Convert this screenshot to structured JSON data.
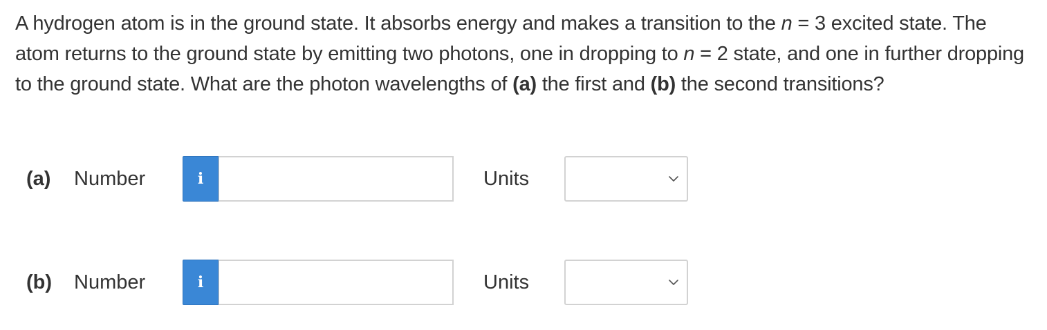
{
  "question": {
    "s1": "A hydrogen atom is in the ground state. It absorbs energy and makes a transition to the ",
    "var1": "n",
    "s2": " = 3 excited state. The atom returns to the ground state by emitting two photons, one in dropping to ",
    "var2": "n",
    "s3": " = 2 state, and one in further dropping to the ground state. What are the photon wavelengths of ",
    "part_a": "(a)",
    "s4": " the first and ",
    "part_b": "(b)",
    "s5": " the second transitions?"
  },
  "answers": [
    {
      "part_label": "(a)",
      "number_label": "Number",
      "info_icon": "i",
      "number_value": "",
      "units_label": "Units",
      "units_selected": ""
    },
    {
      "part_label": "(b)",
      "number_label": "Number",
      "info_icon": "i",
      "number_value": "",
      "units_label": "Units",
      "units_selected": ""
    }
  ],
  "colors": {
    "info_button_bg": "#3a87d6",
    "text": "#333333",
    "input_border": "#d2d2d2"
  },
  "icons": {
    "info": "info-icon",
    "dropdown": "chevron-down-icon"
  }
}
